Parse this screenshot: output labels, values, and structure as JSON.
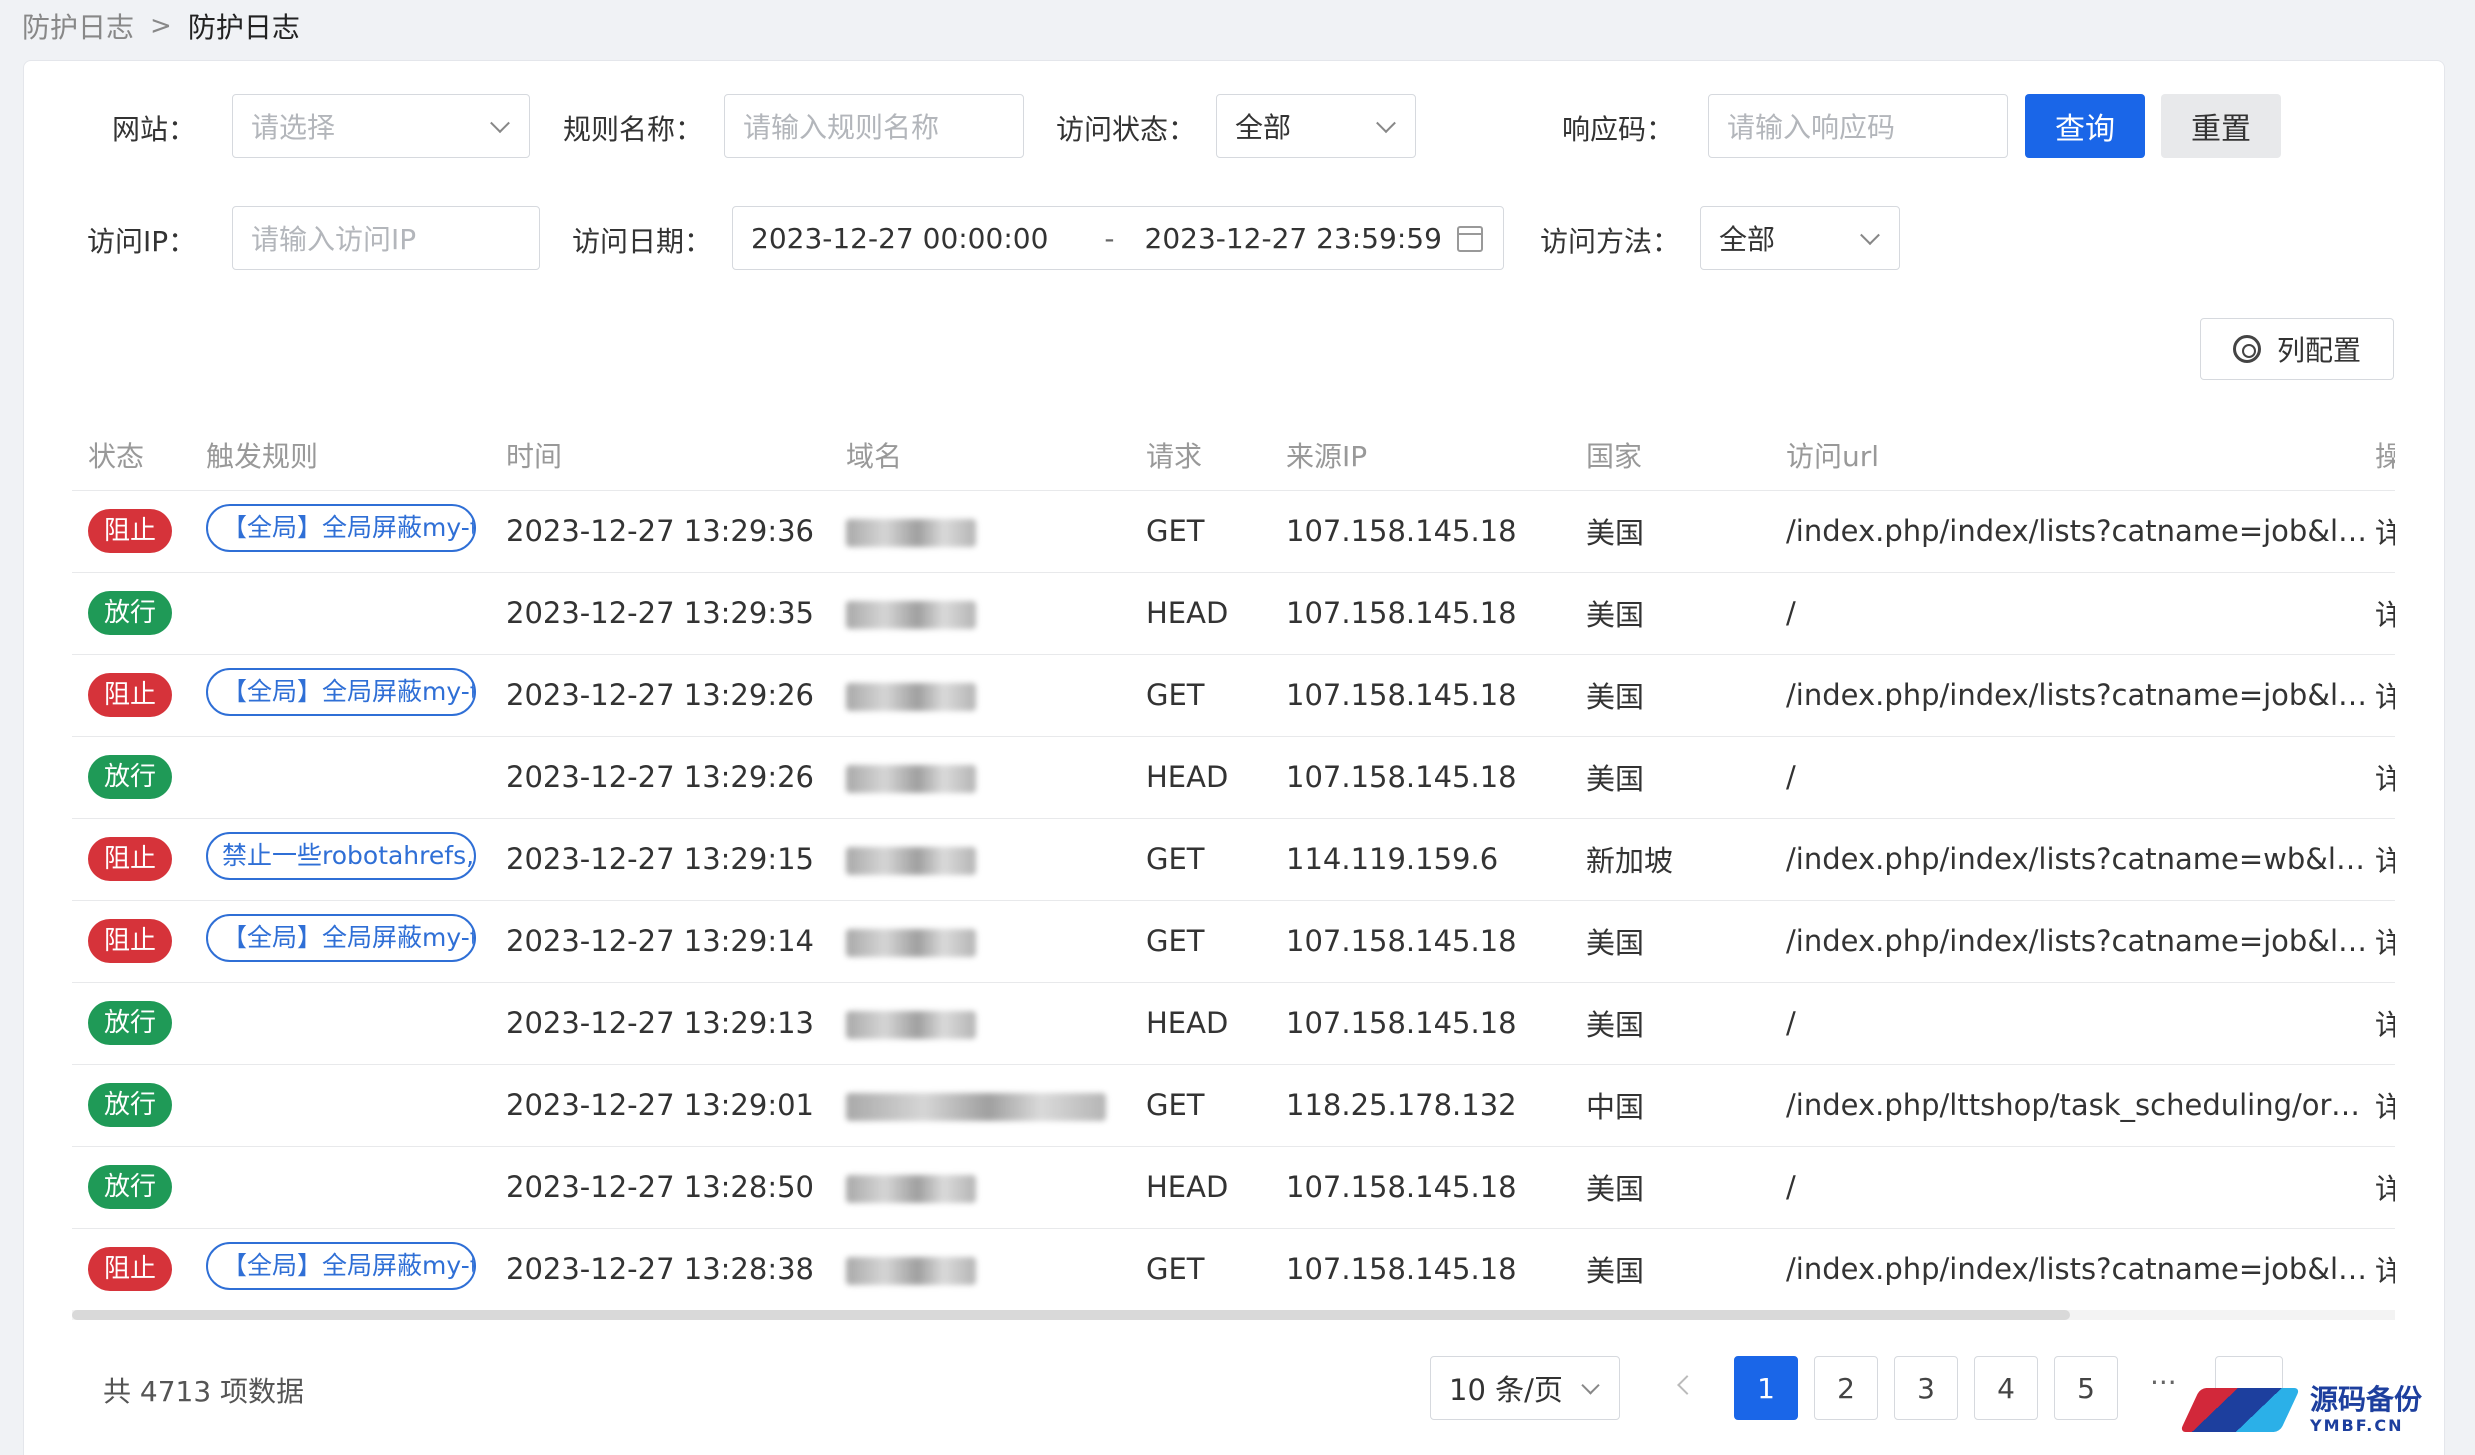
{
  "breadcrumb": {
    "parent": "防护日志",
    "separator": ">",
    "current": "防护日志"
  },
  "filters": {
    "site_label": "网站：",
    "site_placeholder": "请选择",
    "rule_label": "规则名称：",
    "rule_placeholder": "请输入规则名称",
    "status_label": "访问状态：",
    "status_value": "全部",
    "code_label": "响应码：",
    "code_placeholder": "请输入响应码",
    "ip_label": "访问IP：",
    "ip_placeholder": "请输入访问IP",
    "date_label": "访问日期：",
    "date_start": "2023-12-27 00:00:00",
    "date_sep": "-",
    "date_end": "2023-12-27 23:59:59",
    "method_label": "访问方法：",
    "method_value": "全部",
    "query_btn": "查询",
    "reset_btn": "重置"
  },
  "column_config_label": "列配置",
  "table": {
    "headers": [
      "状态",
      "触发规则",
      "时间",
      "域名",
      "请求",
      "来源IP",
      "国家",
      "访问url",
      "操"
    ],
    "rows": [
      {
        "status": "阻止",
        "rule": "【全局】全局屏蔽my-ti",
        "time": "2023-12-27 13:29:36",
        "method": "GET",
        "ip": "107.158.145.18",
        "country": "美国",
        "url": "/index.php/index/lists?catname=job&la...",
        "action": "详"
      },
      {
        "status": "放行",
        "rule": "",
        "time": "2023-12-27 13:29:35",
        "method": "HEAD",
        "ip": "107.158.145.18",
        "country": "美国",
        "url": "/",
        "action": "详"
      },
      {
        "status": "阻止",
        "rule": "【全局】全局屏蔽my-ti",
        "time": "2023-12-27 13:29:26",
        "method": "GET",
        "ip": "107.158.145.18",
        "country": "美国",
        "url": "/index.php/index/lists?catname=job&la...",
        "action": "详"
      },
      {
        "status": "放行",
        "rule": "",
        "time": "2023-12-27 13:29:26",
        "method": "HEAD",
        "ip": "107.158.145.18",
        "country": "美国",
        "url": "/",
        "action": "详"
      },
      {
        "status": "阻止",
        "rule": "禁止一些robotahrefs,",
        "time": "2023-12-27 13:29:15",
        "method": "GET",
        "ip": "114.119.159.6",
        "country": "新加坡",
        "url": "/index.php/index/lists?catname=wb&la...",
        "action": "详"
      },
      {
        "status": "阻止",
        "rule": "【全局】全局屏蔽my-ti",
        "time": "2023-12-27 13:29:14",
        "method": "GET",
        "ip": "107.158.145.18",
        "country": "美国",
        "url": "/index.php/index/lists?catname=job&la...",
        "action": "详"
      },
      {
        "status": "放行",
        "rule": "",
        "time": "2023-12-27 13:29:13",
        "method": "HEAD",
        "ip": "107.158.145.18",
        "country": "美国",
        "url": "/",
        "action": "详"
      },
      {
        "status": "放行",
        "rule": "",
        "time": "2023-12-27 13:29:01",
        "method": "GET",
        "ip": "118.25.178.132",
        "country": "中国",
        "url": "/index.php/lttshop/task_scheduling/ord...",
        "action": "详"
      },
      {
        "status": "放行",
        "rule": "",
        "time": "2023-12-27 13:28:50",
        "method": "HEAD",
        "ip": "107.158.145.18",
        "country": "美国",
        "url": "/",
        "action": "详"
      },
      {
        "status": "阻止",
        "rule": "【全局】全局屏蔽my-ti",
        "time": "2023-12-27 13:28:38",
        "method": "GET",
        "ip": "107.158.145.18",
        "country": "美国",
        "url": "/index.php/index/lists?catname=job&la...",
        "action": "详"
      }
    ]
  },
  "pagination": {
    "total_text": "共 4713 项数据",
    "page_size": "10 条/页",
    "pages": [
      "1",
      "2",
      "3",
      "4",
      "5"
    ],
    "active_page": "1",
    "ellipsis": "···"
  },
  "watermark": {
    "main": "源码备份",
    "sub": "YMBF.CN",
    "logo_char": "码"
  },
  "colors": {
    "primary": "#1a66e8",
    "block": "#d6333a",
    "pass": "#1f9a57",
    "rule_border": "#2f6fd6"
  }
}
